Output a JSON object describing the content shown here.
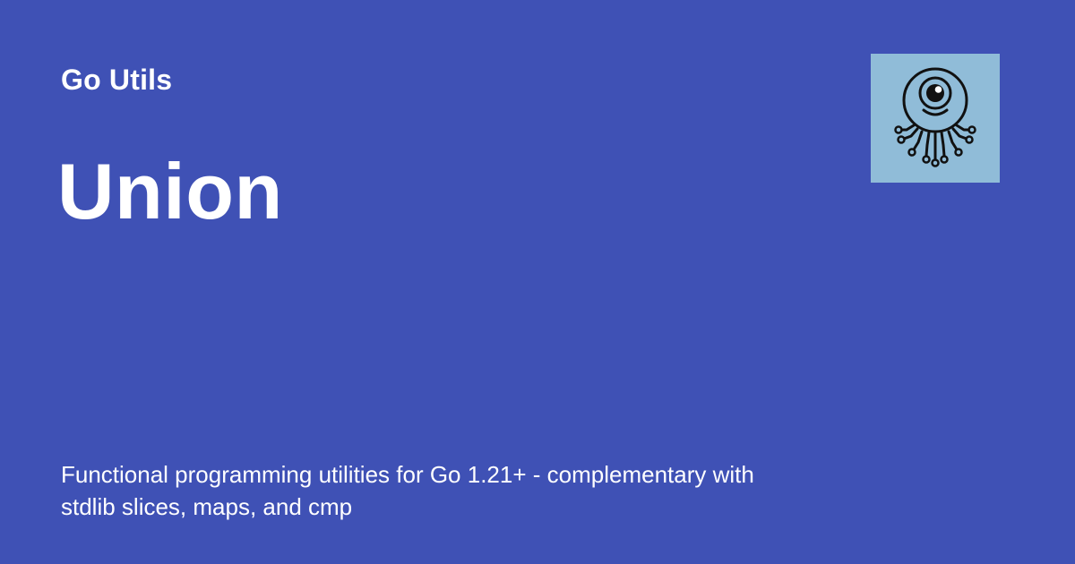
{
  "header": {
    "site_name": "Go Utils"
  },
  "page": {
    "title": "Union",
    "description": "Functional programming utilities for Go 1.21+ - complementary with stdlib slices, maps, and cmp"
  },
  "logo": {
    "icon": "cyclops-octopus-circuit-icon",
    "background_color": "#90bcd8"
  },
  "colors": {
    "background": "#3f51b5",
    "text": "#ffffff",
    "logo_line": "#111111"
  }
}
